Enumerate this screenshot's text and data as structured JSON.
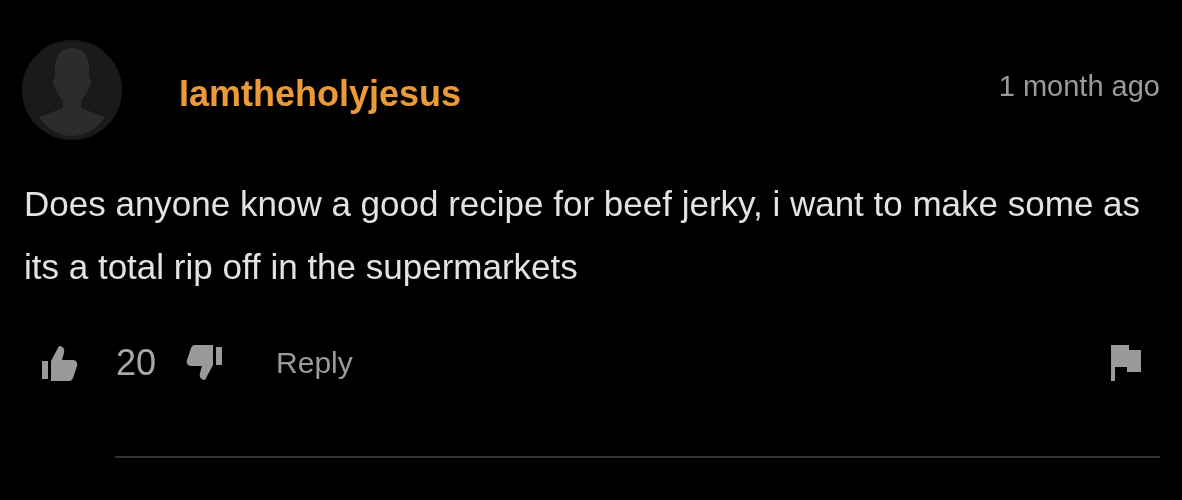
{
  "comment": {
    "username": "Iamtheholyjesus",
    "time": "1 month ago",
    "body": "Does anyone know a good recipe for beef jerky, i want to make some as its a total rip off in the supermarkets",
    "likes": "20",
    "reply": "Reply"
  }
}
